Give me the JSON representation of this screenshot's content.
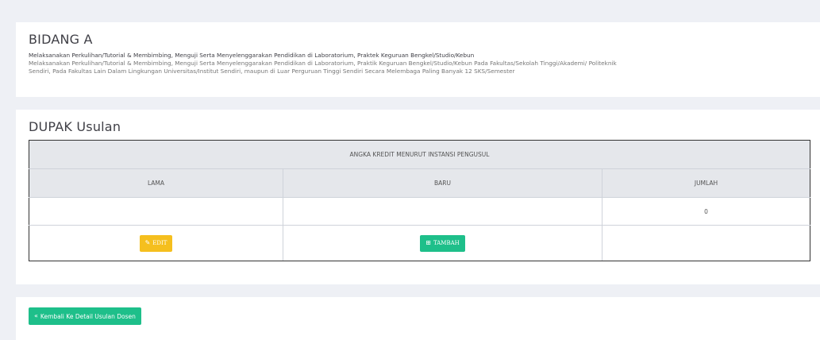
{
  "bidang": {
    "title": "BIDANG A",
    "line1": "Melaksanakan Perkulihan/Tutorial & Membimbing, Menguji Serta Menyelenggarakan Pendidikan di Laboratorium, Praktek Keguruan Bengkel/Studio/Kebun",
    "line2": "Melaksanakan Perkulihan/Tutorial & Membimbing, Menguji Serta Menyelenggarakan Pendidikan di Laboratorium, Praktik Keguruan Bengkel/Studio/Kebun Pada Fakultas/Sekolah Tinggi/Akademi/ Politeknik",
    "line3": "Sendiri, Pada Fakultas Lain Dalam Lingkungan Universitas/Institut Sendiri, maupun di Luar Perguruan Tinggi Sendiri Secara Melembaga Paling Banyak 12 SKS/Semester"
  },
  "dupak": {
    "title": "DUPAK Usulan",
    "table": {
      "group_header": "ANGKA KREDIT MENURUT INSTANSI PENGUSUL",
      "columns": [
        "LAMA",
        "BARU",
        "JUMLAH"
      ],
      "row": {
        "lama": "",
        "baru": "",
        "jumlah": "0"
      }
    },
    "buttons": {
      "edit_label": "EDIT",
      "tambah_label": "TAMBAH"
    }
  },
  "back_button": {
    "label": "Kembali Ke Detail Usulan Dosen"
  },
  "icons": {
    "edit": "edit-icon",
    "tambah": "plus-square-icon",
    "back": "double-left-arrow-icon"
  },
  "colors": {
    "edit": "#f5bf1e",
    "success": "#1ebf8a",
    "header_bg": "#e5e7eb",
    "page_bg": "#eef0f5"
  }
}
